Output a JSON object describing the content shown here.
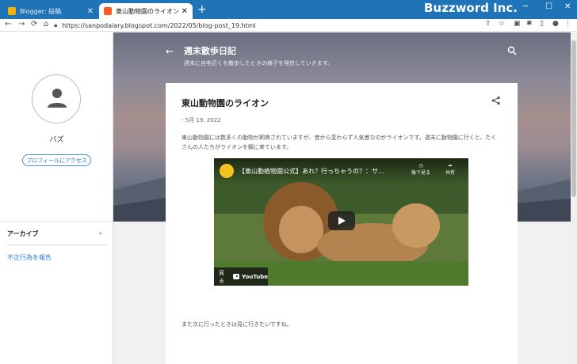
{
  "browser": {
    "tabs": [
      {
        "label": "Blogger: 投稿",
        "active": false,
        "icon": "blogger-icon"
      },
      {
        "label": "東山動物園のライオン",
        "active": true,
        "icon": "blogger-icon"
      }
    ],
    "new_tab": "+",
    "brand": "Buzzword Inc.",
    "window_controls": {
      "minimize": "─",
      "maximize": "☐",
      "close": "✕"
    },
    "url": "https://sanpodaiary.blogspot.com/2022/05/blog-post_19.html",
    "nav": {
      "back": "←",
      "forward": "→",
      "reload": "⟳",
      "home": "⌂"
    }
  },
  "sidebar": {
    "profile_name": "バズ",
    "profile_button": "プロフィールにアクセス",
    "archive_label": "アーカイブ",
    "report_link": "不正行為を報告"
  },
  "header": {
    "blog_title": "週末散歩日記",
    "blog_description": "週末に自宅近くを散歩したときの様子を発信していきます。"
  },
  "post": {
    "title": "東山動物園のライオン",
    "date": "- 5月 19, 2022",
    "body": "東山動物園には数多くの動物が飼育されていますが、昔から変わらず人気者なのがライオンです。週末に動物園に行くと、たくさんの人たちがライオンを観に来ています。",
    "footer": "また次に行ったときは見に行きたいですね。"
  },
  "video": {
    "title": "【東山動植物園公式】あれ？行っちゃうの？：サ...",
    "watch_later": "後で見る",
    "share": "共有",
    "watch_on": "見る",
    "youtube": "YouTube"
  },
  "colors": {
    "titlebar": "#1f73b7",
    "link": "#2a7ad3"
  }
}
